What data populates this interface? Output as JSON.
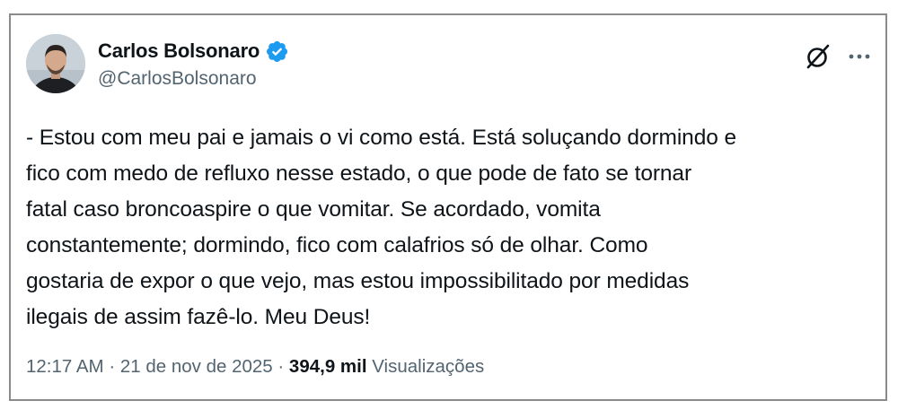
{
  "author": {
    "name": "Carlos Bolsonaro",
    "handle": "@CarlosBolsonaro",
    "verified_color": "#1d9bf0"
  },
  "icons": {
    "verified": "verified-badge-icon",
    "grok": "grok-icon",
    "more": "more-options-icon"
  },
  "tweet": {
    "text": "- Estou com meu pai e jamais o vi como está. Está soluçando dormindo e\nfico com medo de refluxo nesse estado, o que pode de fato se tornar\nfatal caso broncoaspire o que vomitar. Se acordado, vomita\nconstantemente; dormindo, fico com calafrios só de olhar. Como\ngostaria de expor o que vejo, mas estou impossibilitado por medidas\nilegais de assim fazê-lo. Meu Deus!"
  },
  "meta": {
    "time": "12:17 AM",
    "separator": " · ",
    "date": "21 de nov de 2025",
    "views_count": "394,9 mil",
    "views_label": "Visualizações"
  }
}
